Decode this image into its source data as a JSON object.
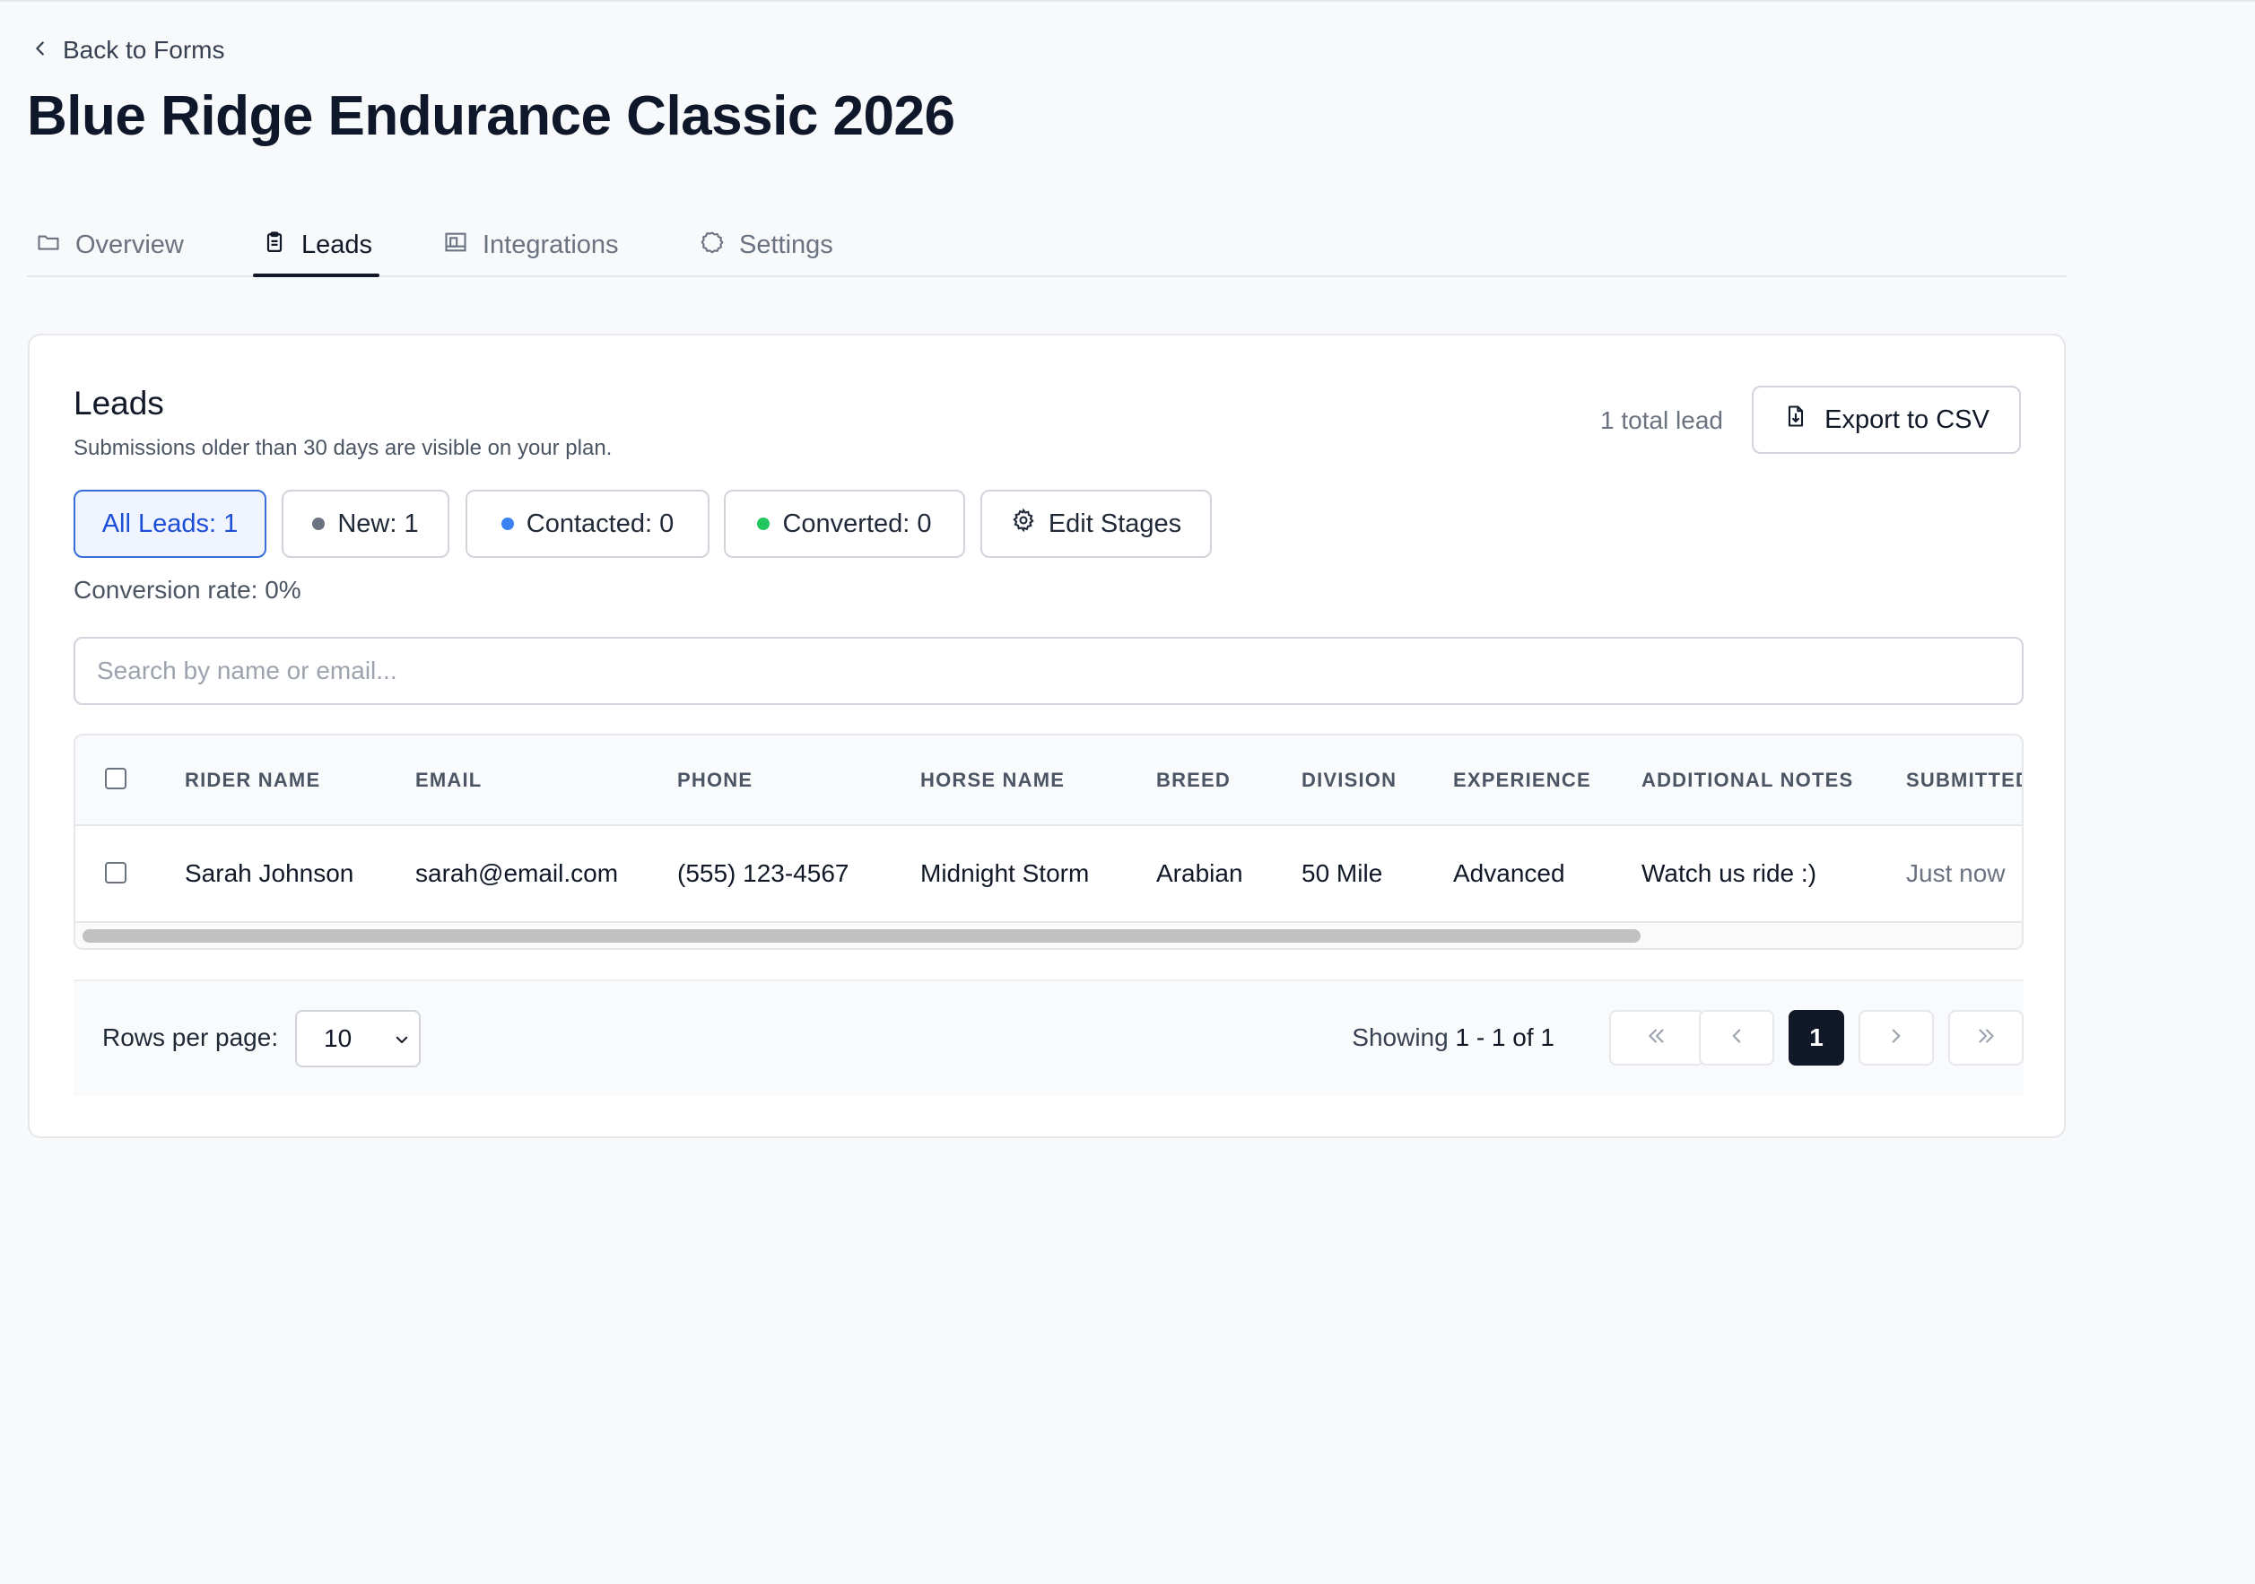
{
  "nav": {
    "back_label": "Back to Forms"
  },
  "page": {
    "title": "Blue Ridge Endurance Classic 2026"
  },
  "tabs": [
    {
      "label": "Overview",
      "icon": "folder-icon"
    },
    {
      "label": "Leads",
      "icon": "clipboard-icon",
      "active": true
    },
    {
      "label": "Integrations",
      "icon": "integrations-icon"
    },
    {
      "label": "Settings",
      "icon": "gear-icon"
    }
  ],
  "leads": {
    "title": "Leads",
    "subtitle": "Submissions older than 30 days are visible on your plan.",
    "total": "1 total lead",
    "export_label": "Export to CSV",
    "filters": [
      {
        "label": "All Leads: 1",
        "active": true
      },
      {
        "label": "New: 1",
        "dot_color": "#6b7280"
      },
      {
        "label": "Contacted: 0",
        "dot_color": "#3b82f6"
      },
      {
        "label": "Converted: 0",
        "dot_color": "#22c55e"
      },
      {
        "label": "Edit Stages",
        "icon": "gear-icon"
      }
    ],
    "conversion_rate": "Conversion rate: 0%",
    "search_placeholder": "Search by name or email..."
  },
  "table": {
    "columns": [
      "RIDER NAME",
      "EMAIL",
      "PHONE",
      "HORSE NAME",
      "BREED",
      "DIVISION",
      "EXPERIENCE",
      "ADDITIONAL NOTES",
      "SUBMITTED"
    ],
    "rows": [
      [
        "Sarah Johnson",
        "sarah@email.com",
        "(555) 123-4567",
        "Midnight Storm",
        "Arabian",
        "50 Mile",
        "Advanced",
        "Watch us ride :)",
        "Just now"
      ]
    ]
  },
  "pagination": {
    "rows_label": "Rows per page:",
    "rows_value": "10",
    "showing_prefix": "Showing",
    "showing_range": "1 - 1",
    "showing_of": "of",
    "showing_total": "1",
    "current_page": "1"
  },
  "colors": {
    "accent": "#1d4ed8",
    "dark": "#111827",
    "border": "#d1d5db"
  }
}
